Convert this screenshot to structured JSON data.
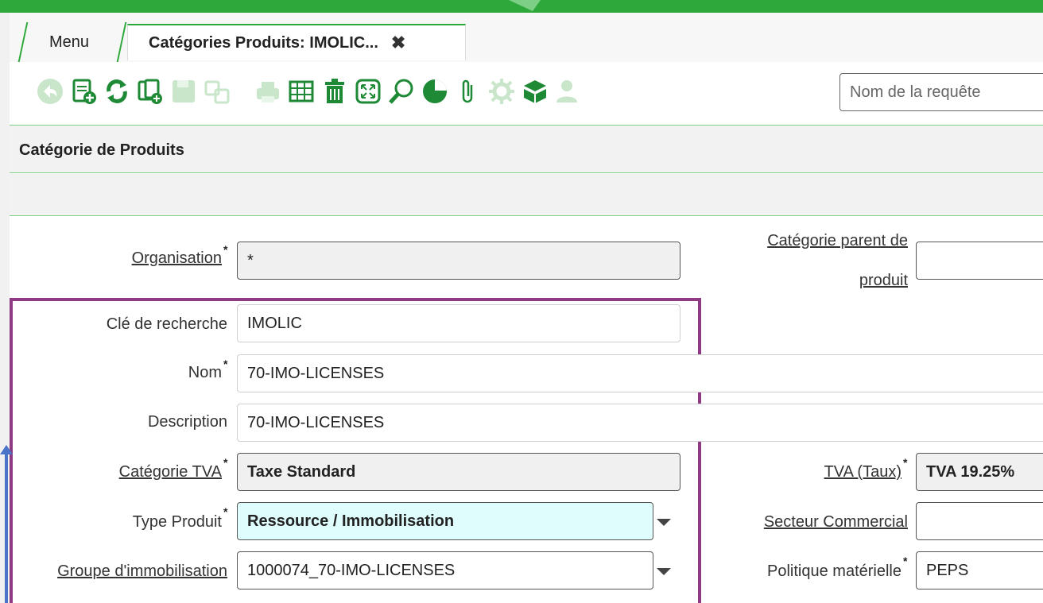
{
  "tabs": {
    "menu_label": "Menu",
    "active_label": "Catégories Produits: IMOLIC...",
    "close_glyph": "✖"
  },
  "toolbar": {
    "icons": [
      "undo-icon",
      "new-record-icon",
      "refresh-icon",
      "copy-record-icon",
      "save-icon",
      "save-new-icon",
      "print-icon",
      "grid-view-icon",
      "delete-icon",
      "fullscreen-icon",
      "find-icon",
      "chart-icon",
      "attachment-icon",
      "settings-icon",
      "archive-icon",
      "user-icon"
    ],
    "search_placeholder": "Nom de la requête"
  },
  "section": {
    "title": "Catégorie de Produits"
  },
  "form": {
    "organisation": {
      "label": "Organisation",
      "value": "*"
    },
    "categorie_parent": {
      "label_line1": "Catégorie parent de",
      "label_line2": "produit",
      "value": ""
    },
    "cle_recherche": {
      "label": "Clé de recherche",
      "value": "IMOLIC"
    },
    "nom": {
      "label": "Nom",
      "value": "70-IMO-LICENSES"
    },
    "description": {
      "label": "Description",
      "value": "70-IMO-LICENSES"
    },
    "categorie_tva": {
      "label": "Catégorie TVA",
      "value": "Taxe Standard"
    },
    "tva_taux": {
      "label": "TVA (Taux)",
      "value": "TVA 19.25%"
    },
    "type_produit": {
      "label": "Type Produit",
      "value": "Ressource / Immobilisation"
    },
    "secteur_commercial": {
      "label": "Secteur Commercial",
      "value": ""
    },
    "groupe_immobilisation": {
      "label": "Groupe d'immobilisation",
      "value": "1000074_70-IMO-LICENSES"
    },
    "politique_materielle": {
      "label": "Politique matérielle",
      "value": "PEPS"
    },
    "required_mark": "*"
  },
  "colors": {
    "brand_green": "#2fa83b",
    "highlight_purple": "#8e3a84",
    "annotation_blue": "#4a74c8"
  }
}
